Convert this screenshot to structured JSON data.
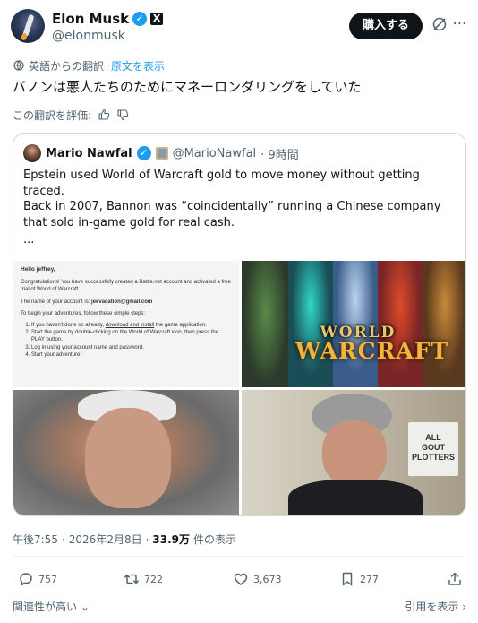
{
  "author": {
    "name": "Elon Musk",
    "handle": "@elonmusk",
    "verified_mark": "✓",
    "x_badge": "X",
    "avatar_icon": "avatar-rocket-icon"
  },
  "header": {
    "buy_button": "購入する",
    "grok_icon": "grok-icon",
    "more_icon": "⋯"
  },
  "translation": {
    "label": "英語からの翻訳",
    "show_original": "原文を表示",
    "rate_label": "この翻訳を評価:"
  },
  "post": {
    "text": "バノンは悪人たちのためにマネーロンダリングをしていた"
  },
  "quote": {
    "name": "Mario Nawfal",
    "handle": "@MarioNawfal",
    "time": "· 9時間",
    "paragraph1": "Epstein used World of Warcraft gold to move money without getting traced.",
    "paragraph2": "Back in 2007, Bannon was “coincidentally” running a Chinese company that sold in-game gold for real cash.",
    "ellipsis": "...",
    "email_image": {
      "hello": "Hello jeffrey,",
      "congrats": "Congratulations! You have successfully created a Battle.net account and activated a free trial of World of Warcraft.",
      "account_prefix": "The name of your account is: ",
      "account_email": "jeevacation@gmail.com",
      "begin": "To begin your adventures, follow these simple steps:",
      "step1_a": "If you haven't done so already, ",
      "step1_link": "download and install",
      "step1_b": " the game application.",
      "step2": "Start the game by double-clicking on the World of Warcraft icon, then press the PLAY button.",
      "step3": "Log in using your account name and password.",
      "step4": "Start your adventure!"
    },
    "wow_logo": {
      "line1": "WORLD",
      "line2": "WARCRAFT"
    },
    "sign_text": "ALL\nGOUT\nPLOTTERS"
  },
  "meta": {
    "time": "午後7:55",
    "separator": "·",
    "date": "2026年2月8日",
    "views_count": "33.9万",
    "views_label": "件の表示"
  },
  "actions": {
    "reply": "757",
    "retweet": "722",
    "like": "3,673",
    "bookmark": "277"
  },
  "footer": {
    "relevance": "関連性が高い ⌄",
    "view_quotes": "引用を表示 ›"
  },
  "colors": {
    "text_primary": "#0f1419",
    "text_secondary": "#536471",
    "accent_blue": "#1d9bf0",
    "border": "#cfd9de"
  }
}
